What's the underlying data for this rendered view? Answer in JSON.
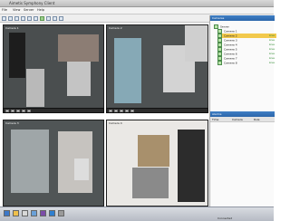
{
  "window": {
    "title": "Aimetis Symphony Client"
  },
  "menu": {
    "items": [
      "File",
      "View",
      "Server",
      "Help"
    ]
  },
  "toolbar": {
    "buttons": [
      "back-icon",
      "forward-icon",
      "layout-icon",
      "grid-1x1-icon",
      "grid-2x2-icon",
      "grid-3x3-icon",
      "record-icon",
      "search-icon",
      "settings-icon",
      "alarm-icon"
    ]
  },
  "cameras": [
    {
      "id": "cam-1",
      "label": "Camera 1"
    },
    {
      "id": "cam-2",
      "label": "Camera 2"
    },
    {
      "id": "cam-3",
      "label": "Camera 3"
    },
    {
      "id": "cam-4",
      "label": "Camera 4"
    }
  ],
  "sidepanel": {
    "title": "Cameras",
    "items": [
      {
        "label": "Server"
      },
      {
        "label": "Camera 1"
      },
      {
        "label": "Camera 2",
        "status": "Live"
      },
      {
        "label": "Camera 3",
        "status": "Live"
      },
      {
        "label": "Camera 4",
        "status": "Live"
      },
      {
        "label": "Camera 5",
        "status": "Live"
      },
      {
        "label": "Camera 6",
        "status": "Live"
      },
      {
        "label": "Camera 7",
        "status": "Live"
      },
      {
        "label": "Camera 8",
        "status": "Live"
      }
    ],
    "lower_title": "Alarms",
    "grid_headers": [
      "Time",
      "Camera",
      "Rule"
    ]
  },
  "status": {
    "text": "Connected"
  },
  "colors": {
    "panel_header": "#2b66aa",
    "status_live": "#2e8b2e",
    "highlight": "#f2c94c"
  }
}
